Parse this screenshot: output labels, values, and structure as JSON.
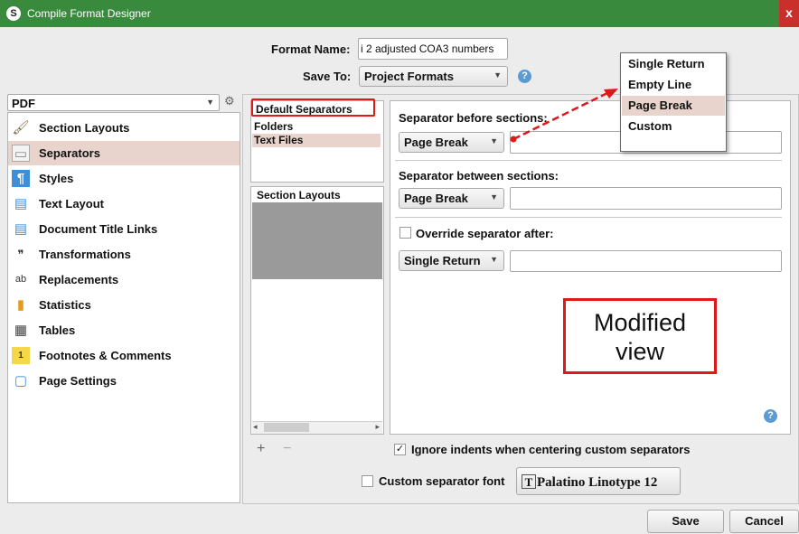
{
  "window": {
    "title": "Compile Format Designer",
    "app_icon_glyph": "S",
    "close_glyph": "x"
  },
  "header": {
    "format_name_label": "Format Name:",
    "format_name_value": "i 2 adjusted COA3 numbers",
    "save_to_label": "Save To:",
    "save_to_value": "Project Formats",
    "help_glyph": "?"
  },
  "format_selector": {
    "value": "PDF",
    "settings_icon": "gear-icon"
  },
  "sidebar": {
    "items": [
      {
        "label": "Section Layouts",
        "icon": "brush-icon",
        "glyph": "🖌"
      },
      {
        "label": "Separators",
        "icon": "separators-icon",
        "glyph": "▭",
        "selected": true
      },
      {
        "label": "Styles",
        "icon": "styles-icon",
        "glyph": "¶"
      },
      {
        "label": "Text Layout",
        "icon": "text-layout-icon",
        "glyph": "▤"
      },
      {
        "label": "Document Title Links",
        "icon": "document-icon",
        "glyph": "▤"
      },
      {
        "label": "Transformations",
        "icon": "quotes-icon",
        "glyph": "❞"
      },
      {
        "label": "Replacements",
        "icon": "replace-icon",
        "glyph": "ab"
      },
      {
        "label": "Statistics",
        "icon": "bar-chart-icon",
        "glyph": "▮"
      },
      {
        "label": "Tables",
        "icon": "table-icon",
        "glyph": "▦"
      },
      {
        "label": "Footnotes & Comments",
        "icon": "footnote-icon",
        "glyph": "1"
      },
      {
        "label": "Page Settings",
        "icon": "page-icon",
        "glyph": "▢"
      }
    ]
  },
  "separators_list": {
    "header": "Default Separators",
    "items": [
      {
        "label": "Folders"
      },
      {
        "label": "Text Files",
        "selected": true
      }
    ]
  },
  "section_layouts_list": {
    "header": "Section Layouts",
    "add_glyph": "+",
    "remove_glyph": "−",
    "scroll_left": "◂",
    "scroll_right": "▸"
  },
  "settings": {
    "before_label": "Separator before sections:",
    "before_value": "Page Break",
    "between_label": "Separator between sections:",
    "between_value": "Page Break",
    "override_label": "Override separator after:",
    "override_value": "Single Return",
    "ignore_indents_label": "Ignore indents when centering custom separators",
    "ignore_indents_checked": "✓",
    "custom_font_label": "Custom separator font",
    "font_button_value": "Palatino Linotype 12"
  },
  "dropdown": {
    "options": [
      "Single Return",
      "Empty Line",
      "Page Break",
      "Custom"
    ],
    "selected_index": 2
  },
  "annotation": {
    "line1": "Modified",
    "line2": "view"
  },
  "footer": {
    "save_label": "Save",
    "cancel_label": "Cancel"
  },
  "colors": {
    "titlebar": "#3a8a3e",
    "selection": "#e8d4cc",
    "annotation_red": "#e0171b"
  }
}
